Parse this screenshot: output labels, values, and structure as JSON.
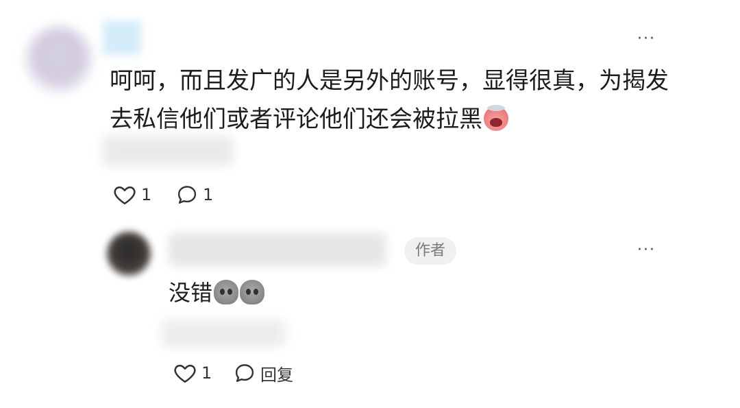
{
  "comment": {
    "text": "呵呵，而且发广的人是另外的账号，显得很真，为揭发去私信他们或者评论他们还会被拉黑",
    "emoji": "crying-face-sticker",
    "likes": "1",
    "replies": "1",
    "more": "···"
  },
  "reply": {
    "author_badge": "作者",
    "text": "没错",
    "emojis": [
      "gray-face-sticker",
      "gray-face-sticker"
    ],
    "likes": "1",
    "reply_label": "回复",
    "more": "···"
  }
}
